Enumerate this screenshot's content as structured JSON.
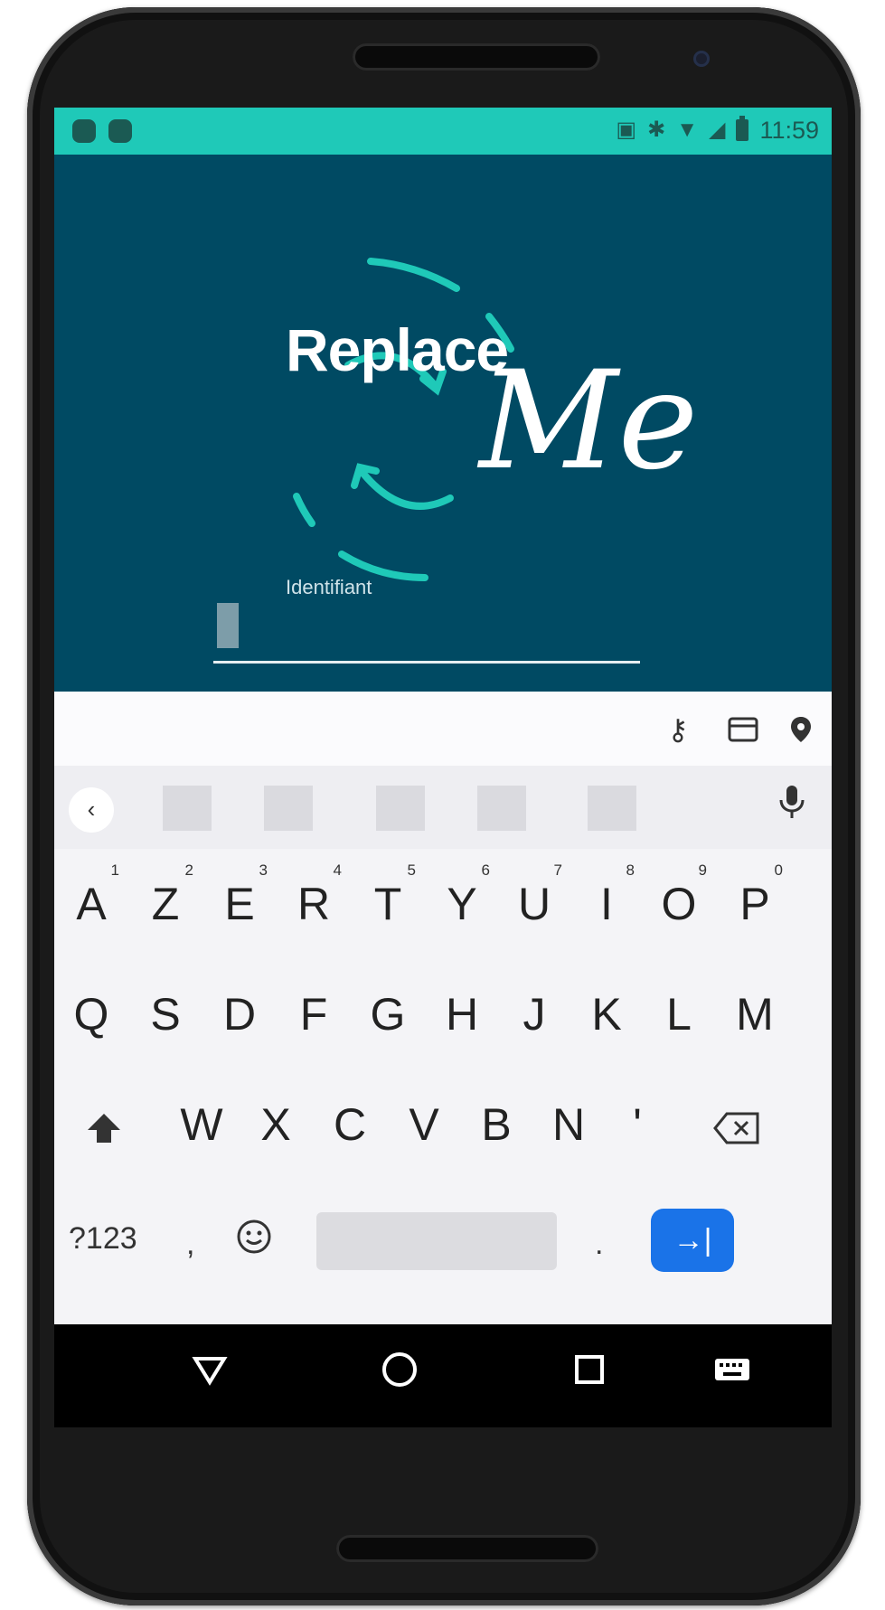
{
  "status_bar": {
    "time": "11:59"
  },
  "logo": {
    "word1": "Replace",
    "word2": "Me",
    "accent_color": "#1fc9b8"
  },
  "login": {
    "field_label": "Identifiant"
  },
  "keyboard": {
    "row1": [
      {
        "key": "A",
        "hint": "1"
      },
      {
        "key": "Z",
        "hint": "2"
      },
      {
        "key": "E",
        "hint": "3"
      },
      {
        "key": "R",
        "hint": "4"
      },
      {
        "key": "T",
        "hint": "5"
      },
      {
        "key": "Y",
        "hint": "6"
      },
      {
        "key": "U",
        "hint": "7"
      },
      {
        "key": "I",
        "hint": "8"
      },
      {
        "key": "O",
        "hint": "9"
      },
      {
        "key": "P",
        "hint": "0"
      }
    ],
    "row2": [
      "Q",
      "S",
      "D",
      "F",
      "G",
      "H",
      "J",
      "K",
      "L",
      "M"
    ],
    "row3": [
      "W",
      "X",
      "C",
      "V",
      "B",
      "N",
      "'"
    ],
    "symbols_key": "?123",
    "comma_key": ",",
    "period_key": ".",
    "enter_symbol": "→|"
  },
  "icons": {
    "autofill": [
      "key-off-icon",
      "card-icon",
      "location-pin-icon"
    ],
    "navigation": [
      "back-triangle-icon",
      "home-circle-icon",
      "recents-square-icon",
      "keyboard-switch-icon"
    ]
  },
  "colors": {
    "status_bar": "#1fc9b8",
    "background": "#004a63",
    "enter_key": "#1a73e8"
  }
}
